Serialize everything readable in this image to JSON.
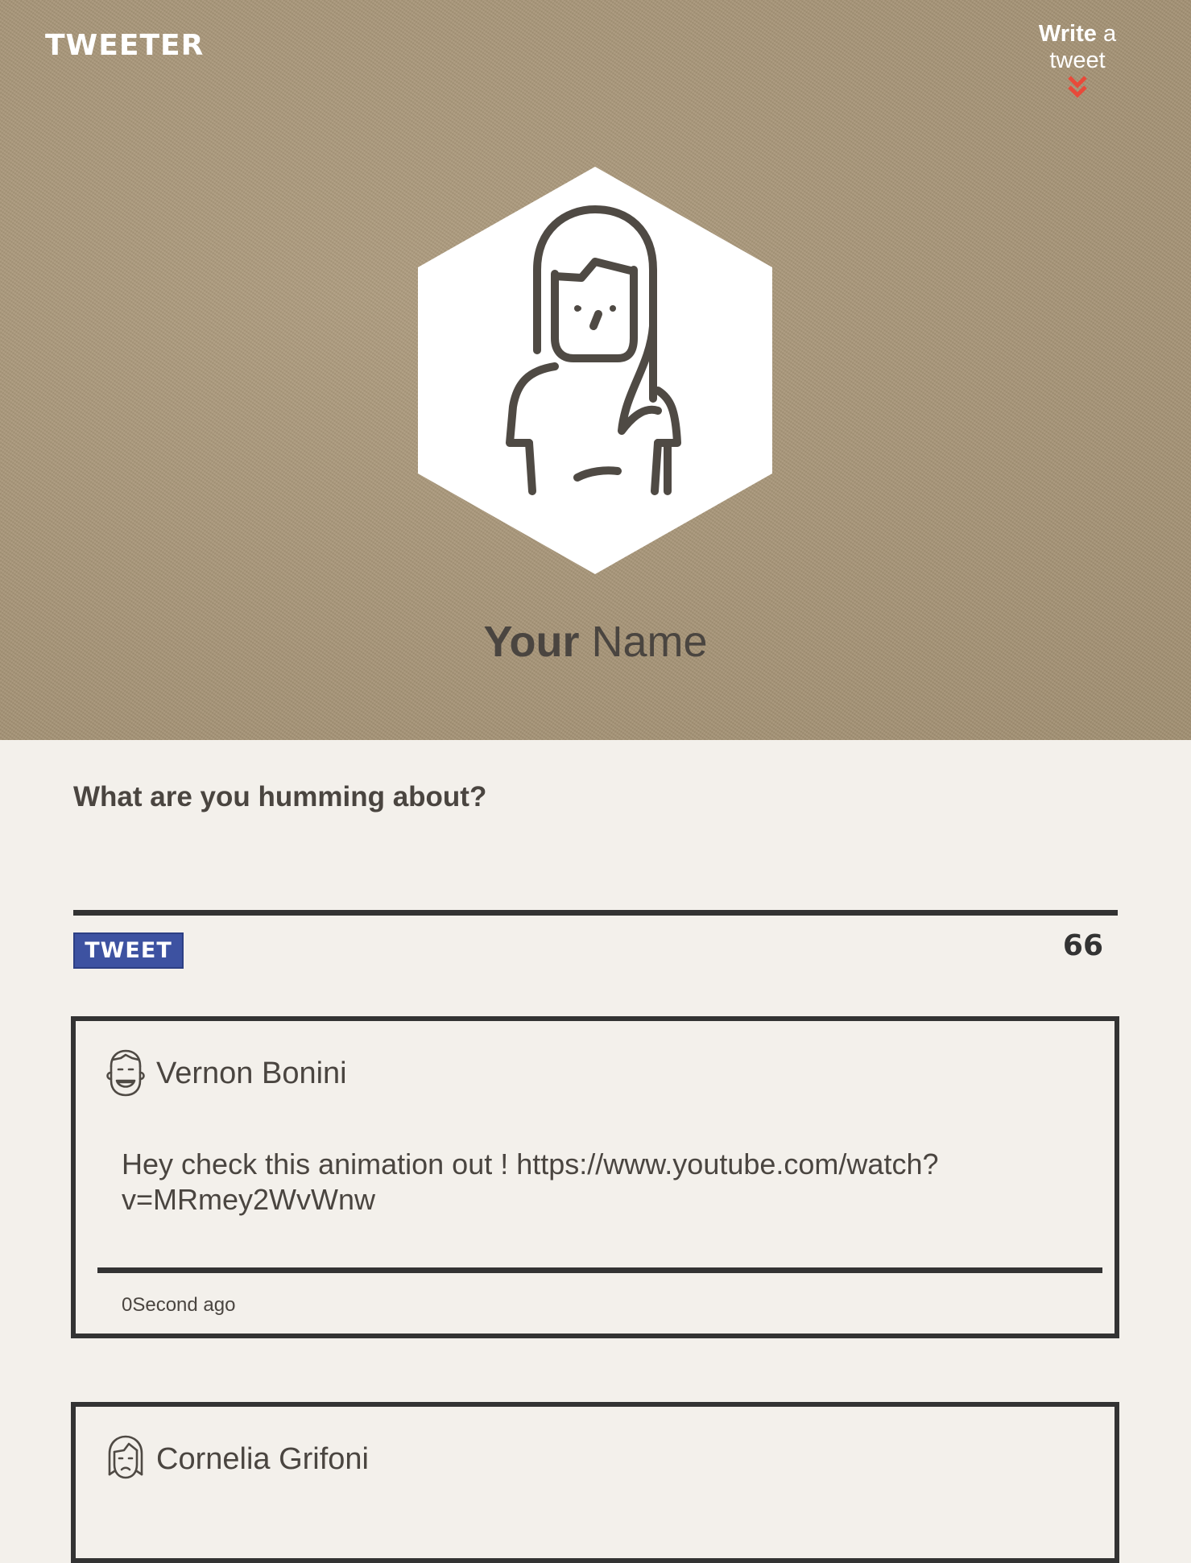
{
  "header": {
    "logo": "TWEETER",
    "write_link_bold": "Write",
    "write_link_rest": " a tweet"
  },
  "profile": {
    "first": "Your",
    "last": " Name"
  },
  "compose": {
    "prompt": "What are you humming about?",
    "value": "",
    "button_label": "TWEET",
    "char_count": "66"
  },
  "tweets": [
    {
      "author": "Vernon Bonini",
      "text": "Hey check this animation out ! https://www.youtube.com/watch?v=MRmey2WvWnw",
      "time": "0Second ago"
    },
    {
      "author": "Cornelia Grifoni"
    }
  ],
  "colors": {
    "hero_bg": "#a99677",
    "page_bg": "#f3f0eb",
    "accent_button": "#3d52a1",
    "chevron": "#e84a3a",
    "ink": "#333333"
  },
  "icons": {
    "write_link": "double-chevron-down-icon",
    "profile": "woman-avatar-icon",
    "tweet_1": "smiling-man-avatar-icon",
    "tweet_2": "woman-avatar-icon"
  }
}
